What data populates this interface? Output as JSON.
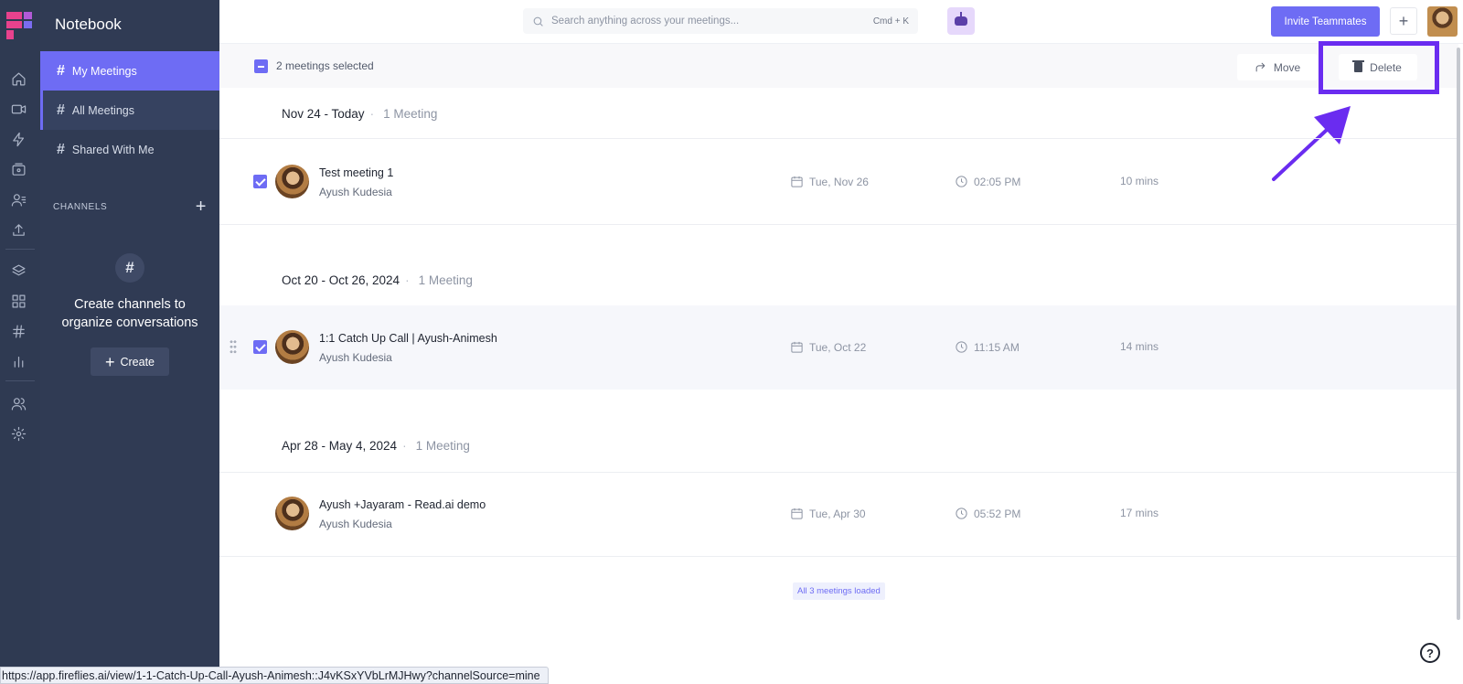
{
  "app": {
    "name": "Notebook"
  },
  "rail": {
    "icons": [
      "home-icon",
      "video-icon",
      "bolt-icon",
      "record-icon",
      "contacts-icon",
      "upload-icon",
      "layers-icon",
      "grid-icon",
      "hashtag-icon",
      "analytics-icon",
      "team-icon",
      "settings-icon"
    ]
  },
  "sidebar": {
    "items": [
      {
        "label": "My Meetings",
        "state": "active"
      },
      {
        "label": "All Meetings",
        "state": "hover"
      },
      {
        "label": "Shared With Me",
        "state": "normal"
      }
    ],
    "channels_title": "CHANNELS",
    "empty_message": "Create channels to organize conversations",
    "create_label": "Create"
  },
  "topbar": {
    "search_placeholder": "Search anything across your meetings...",
    "search_shortcut": "Cmd + K",
    "invite_label": "Invite Teammates",
    "add_label": "+"
  },
  "selection": {
    "text": "2 meetings selected",
    "move_label": "Move",
    "delete_label": "Delete"
  },
  "groups": [
    {
      "title": "Nov 24 - Today",
      "count": "1 Meeting",
      "meetings": [
        {
          "title": "Test meeting 1",
          "owner": "Ayush Kudesia",
          "date": "Tue, Nov 26",
          "time": "02:05 PM",
          "duration": "10 mins",
          "selected": true
        }
      ]
    },
    {
      "title": "Oct 20 - Oct 26, 2024",
      "count": "1 Meeting",
      "meetings": [
        {
          "title": "1:1 Catch Up Call | Ayush-Animesh",
          "owner": "Ayush Kudesia",
          "date": "Tue, Oct 22",
          "time": "11:15 AM",
          "duration": "14 mins",
          "selected": true
        }
      ]
    },
    {
      "title": "Apr 28 - May 4, 2024",
      "count": "1 Meeting",
      "meetings": [
        {
          "title": "Ayush +Jayaram - Read.ai demo",
          "owner": "Ayush Kudesia",
          "date": "Tue, Apr 30",
          "time": "05:52 PM",
          "duration": "17 mins",
          "selected": false
        }
      ]
    }
  ],
  "footer": {
    "loaded_text": "All 3 meetings loaded",
    "help": "?"
  },
  "status_url": "https://app.fireflies.ai/view/1-1-Catch-Up-Call-Ayush-Animesh::J4vKSxYVbLrMJHwy?channelSource=mine",
  "colors": {
    "accent": "#6e6cf4",
    "sidebar": "#303b54",
    "highlight": "#6a2cf0"
  }
}
